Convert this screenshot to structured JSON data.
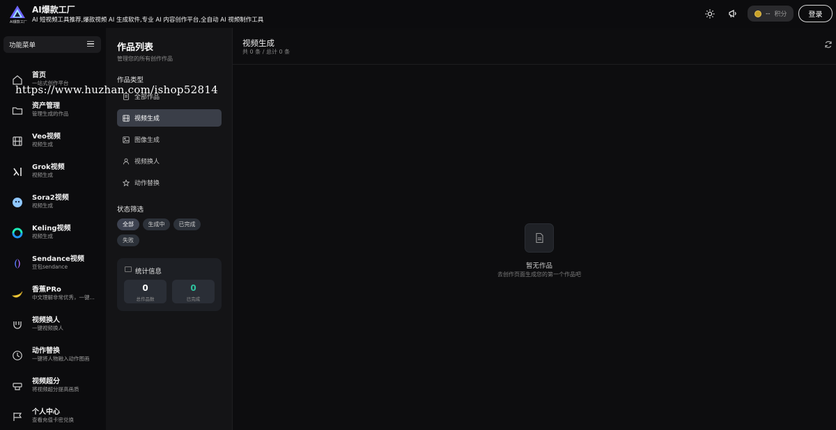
{
  "header": {
    "brand_title": "AI爆款工厂",
    "brand_subtitle": "AI 短视频工具推荐,爆款视频 AI 生成软件,专业 AI 内容创作平台,全自动 AI 视频制作工具",
    "logo_text": "AI爆款工厂",
    "credits_value": "--",
    "credits_label": "积分",
    "login_label": "登录",
    "icons": [
      "sun-icon",
      "megaphone-icon",
      "coin-icon"
    ]
  },
  "sidebar": {
    "menu_label": "功能菜单",
    "items": [
      {
        "title": "首页",
        "desc": "一站式创作平台",
        "icon": "home-icon"
      },
      {
        "title": "资产管理",
        "desc": "管理生成的作品",
        "icon": "folder-icon"
      },
      {
        "title": "Veo视频",
        "desc": "视频生成",
        "icon": "film-icon"
      },
      {
        "title": "Grok视频",
        "desc": "视频生成",
        "icon": "grok-icon"
      },
      {
        "title": "Sora2视频",
        "desc": "视频生成",
        "icon": "sora-icon"
      },
      {
        "title": "Keling视频",
        "desc": "视频生成",
        "icon": "keling-icon"
      },
      {
        "title": "Sendance视频",
        "desc": "豆包sendance",
        "icon": "sendance-icon"
      },
      {
        "title": "香蕉PRo",
        "desc": "中文理解非常优秀，一键...",
        "icon": "banana-icon"
      },
      {
        "title": "视频换人",
        "desc": "一键视频换人",
        "icon": "magnet-icon"
      },
      {
        "title": "动作替换",
        "desc": "一键将人物融入动作图画",
        "icon": "clock-icon"
      },
      {
        "title": "视频超分",
        "desc": "将视频超分提高画质",
        "icon": "upscale-icon"
      },
      {
        "title": "个人中心",
        "desc": "查看充值卡密兑换",
        "icon": "flag-icon"
      }
    ]
  },
  "works": {
    "title": "作品列表",
    "subtitle": "管理您的所有创作作品",
    "type_label": "作品类型",
    "types": [
      {
        "label": "全部作品",
        "icon": "doc-icon"
      },
      {
        "label": "视频生成",
        "icon": "film-icon"
      },
      {
        "label": "图像生成",
        "icon": "image-icon"
      },
      {
        "label": "视频换人",
        "icon": "user-icon"
      },
      {
        "label": "动作替换",
        "icon": "star-icon"
      }
    ],
    "active_type": "视频生成",
    "status_label": "状态筛选",
    "statuses": [
      "全部",
      "生成中",
      "已完成",
      "失败"
    ],
    "active_status": "全部",
    "stats_title": "统计信息",
    "stats": [
      {
        "value": "0",
        "label": "总作品数",
        "color": "#ffffff"
      },
      {
        "value": "0",
        "label": "已完成",
        "color": "#2ec4a0"
      }
    ]
  },
  "main": {
    "title": "视频生成",
    "count_text": "共 0 条 / 总计 0 条",
    "empty_title": "暂无作品",
    "empty_desc": "去创作页面生成您的第一个作品吧"
  },
  "watermark": "https://www.huzhan.com/ishop52814"
}
